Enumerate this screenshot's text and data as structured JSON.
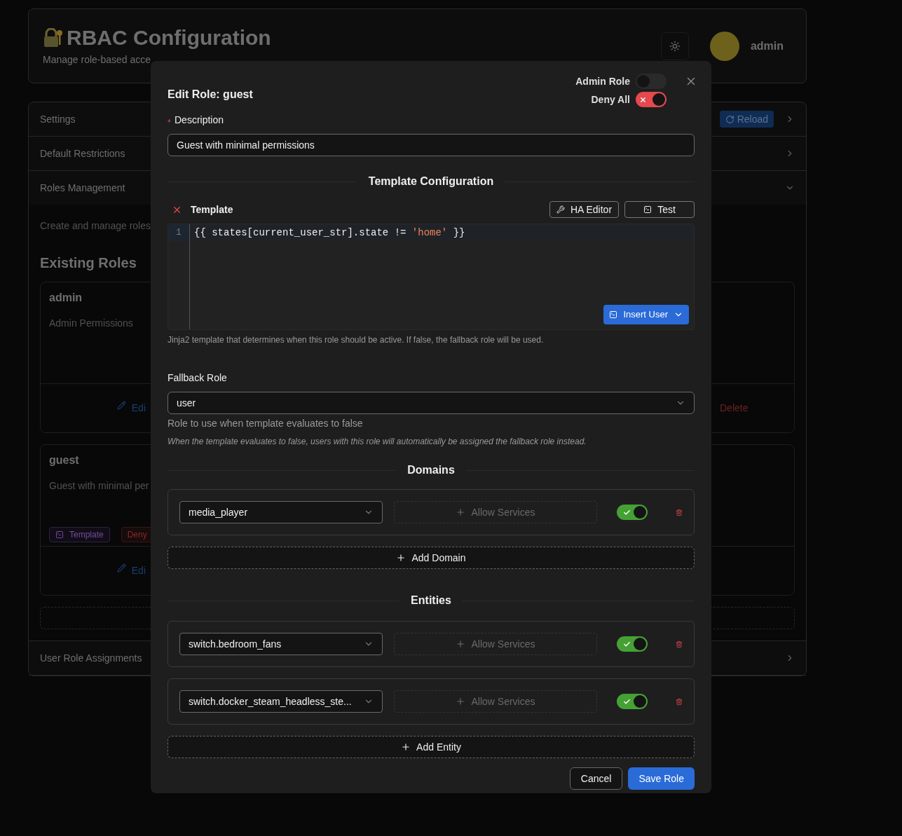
{
  "header": {
    "title": "RBAC Configuration",
    "subtitle": "Manage role-based acce",
    "user": "admin"
  },
  "sections": [
    {
      "title": "Settings",
      "expanded": false,
      "action": "Reload"
    },
    {
      "title": "Default Restrictions",
      "expanded": false
    },
    {
      "title": "Roles Management",
      "expanded": true
    }
  ],
  "roles_management": {
    "intro": "Create and manage roles",
    "heading": "Existing Roles",
    "roles": [
      {
        "name": "admin",
        "description": "Admin Permissions",
        "edit": "Edi",
        "delete": "Delete"
      },
      {
        "name": "guest",
        "description": "Guest with minimal per",
        "badges": [
          {
            "label": "Template",
            "kind": "template"
          },
          {
            "label": "Deny",
            "kind": "deny"
          }
        ],
        "edit": "Edi"
      }
    ]
  },
  "last_section": {
    "title": "User Role Assignments",
    "expanded": false
  },
  "dialog": {
    "title": "Edit Role: guest",
    "toggles": [
      {
        "label": "Admin Role",
        "on": false,
        "kind": "neutral"
      },
      {
        "label": "Deny All",
        "on": true,
        "kind": "danger"
      }
    ],
    "required_mark": "*",
    "description": {
      "label": "Description",
      "required": true,
      "value": "Guest with minimal permissions"
    },
    "template_heading": "Template Configuration",
    "template": {
      "label": "Template",
      "buttons": [
        "HA Editor",
        "Test"
      ],
      "line_number": "1",
      "code": [
        {
          "text": "{{ states[current_user_str].state != ",
          "kind": "plain"
        },
        {
          "text": "'home'",
          "kind": "string"
        },
        {
          "text": " }}",
          "kind": "plain"
        }
      ],
      "insert_button": "Insert User",
      "help": "Jinja2 template that determines when this role should be active. If false, the fallback role will be used."
    },
    "fallback": {
      "label": "Fallback Role",
      "value": "user",
      "hint": "Role to use when template evaluates to false",
      "note": "When the template evaluates to false, users with this role will automatically be assigned the fallback role instead."
    },
    "domains": {
      "heading": "Domains",
      "items": [
        {
          "value": "media_player",
          "allow": "Allow Services",
          "on": true
        }
      ],
      "add": "Add Domain"
    },
    "entities": {
      "heading": "Entities",
      "items": [
        {
          "value": "switch.bedroom_fans",
          "allow": "Allow Services",
          "on": true
        },
        {
          "value": "switch.docker_steam_headless_ste...",
          "allow": "Allow Services",
          "on": true
        }
      ],
      "add": "Add Entity"
    },
    "buttons": [
      {
        "label": "Cancel",
        "kind": "secondary"
      },
      {
        "label": "Save Role",
        "kind": "primary"
      }
    ]
  }
}
